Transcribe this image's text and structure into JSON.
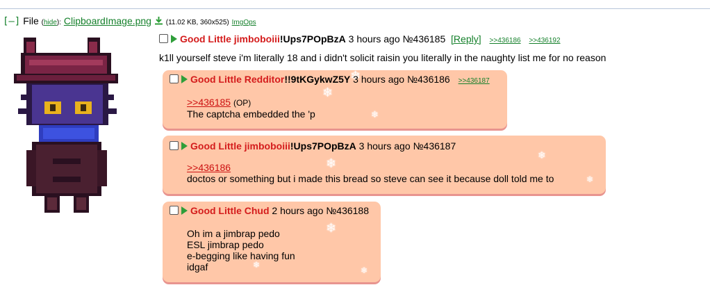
{
  "file": {
    "toggle": "[–]",
    "label": "File",
    "hide": "hide",
    "filename": "ClipboardImage.png",
    "meta": "(11.02 KB, 360x525)",
    "imgops": "ImgOps"
  },
  "op": {
    "name": "Good Little jimboboiii",
    "trip": "!Ups7POpBzA",
    "time": "3 hours ago",
    "number": "№436185",
    "reply": "[Reply]",
    "backlinks": [
      ">>436186",
      ">>436192"
    ],
    "body": "k1ll yourself steve i'm literally 18 and i didn't solicit raisin you literally in the naughty list me for no reason"
  },
  "replies": [
    {
      "name": "Good Little Redditor",
      "trip": "!!9tKGykwZ5Y",
      "time": "3 hours ago",
      "number": "№436186",
      "backlink": ">>436187",
      "quote": ">>436185",
      "quote_tag": "(OP)",
      "lines": [
        "The captcha embedded the 'p"
      ]
    },
    {
      "name": "Good Little jimboboiii",
      "trip": "!Ups7POpBzA",
      "time": "3 hours ago",
      "number": "№436187",
      "quote": ">>436186",
      "lines": [
        "doctos or something but i made this bread so steve can see it because doll told me to"
      ]
    },
    {
      "name": "Good Little Chud",
      "time": "2 hours ago",
      "number": "№436188",
      "lines": [
        "Oh im a jimbrap pedo",
        "ESL jimbrap pedo",
        "e-begging like having fun",
        "idgaf"
      ]
    }
  ],
  "colors": {
    "name": "#d41c1c",
    "link": "#15802b",
    "quote": "#cc1111",
    "reply_bg": "#ffc7a8"
  }
}
